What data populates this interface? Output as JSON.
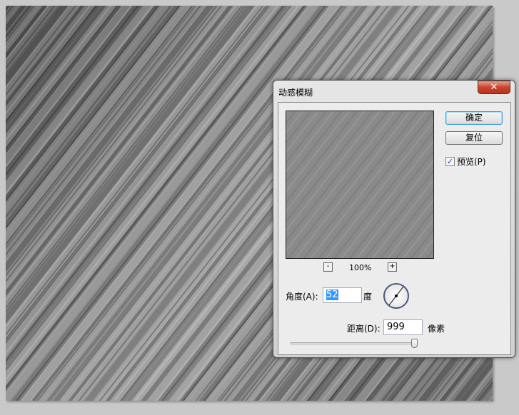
{
  "dialog": {
    "title": "动感模糊",
    "close_label": "✕",
    "ok_label": "确定",
    "reset_label": "复位",
    "preview_label": "预览(P)",
    "preview_checked": true,
    "zoom_minus": "-",
    "zoom_plus": "+",
    "zoom_value": "100%",
    "angle_label": "角度(A):",
    "angle_value": "52",
    "angle_unit": "度",
    "distance_label": "距离(D):",
    "distance_value": "999",
    "distance_unit": "像素",
    "distance_slider_fraction": 1.0
  }
}
